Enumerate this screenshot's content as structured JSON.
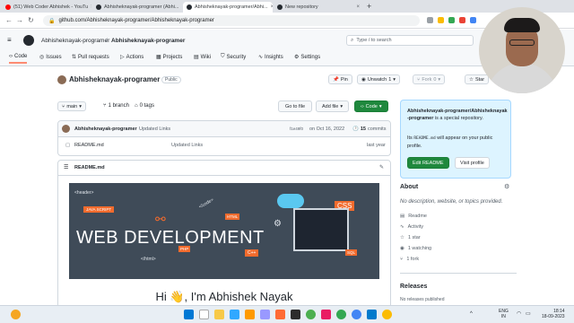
{
  "browser": {
    "tabs": [
      {
        "title": "(51) Web Coder Abhishek - YouTu",
        "color": "#ff0000",
        "active": false
      },
      {
        "title": "Abhisheknayak-programer (Abhi...",
        "color": "#24292f",
        "active": false
      },
      {
        "title": "Abhisheknayak-programer/Abhi...",
        "color": "#24292f",
        "active": true
      },
      {
        "title": "New repository",
        "color": "#24292f",
        "active": false
      }
    ],
    "url": "github.com/Abhisheknayak-programer/Abhisheknayak-programer"
  },
  "github": {
    "owner": "Abhisheknayak-programer",
    "sep": "/",
    "repo": "Abhisheknayak-programer",
    "search_placeholder": "Type / to search",
    "nav": [
      {
        "label": "Code",
        "icon": "code-icon"
      },
      {
        "label": "Issues",
        "icon": "issue-icon"
      },
      {
        "label": "Pull requests",
        "icon": "pr-icon"
      },
      {
        "label": "Actions",
        "icon": "play-icon"
      },
      {
        "label": "Projects",
        "icon": "table-icon"
      },
      {
        "label": "Wiki",
        "icon": "book-icon"
      },
      {
        "label": "Security",
        "icon": "shield-icon"
      },
      {
        "label": "Insights",
        "icon": "graph-icon"
      },
      {
        "label": "Settings",
        "icon": "gear-icon"
      }
    ]
  },
  "repo": {
    "title": "Abhisheknayak-programer",
    "visibility": "Public",
    "pin": "Pin",
    "unwatch": "Unwatch",
    "watch_count": "1",
    "fork": "Fork",
    "fork_count": "0",
    "star": "Star",
    "branch": "main",
    "branches": "1 branch",
    "tags": "0 tags",
    "goto_file": "Go to file",
    "add_file": "Add file",
    "code_btn": "Code",
    "commit_author": "Abhisheknayak-programer",
    "commit_msg": "Updated Links",
    "commit_hash": "f1e49f0",
    "commit_date": "on Oct 16, 2022",
    "commits": "15",
    "commits_label": "commits",
    "file_name": "README.md",
    "file_msg": "Updated Links",
    "file_time": "last year",
    "readme_header": "README.md",
    "banner": {
      "text": "WEB DEVELOPMENT",
      "tags": [
        "<header>",
        "JAVA SCRIPT",
        "</code>",
        "HTML",
        "CSS",
        "PHP",
        "C++",
        "</html>",
        "SQL"
      ]
    },
    "greeting": "Hi 👋, I'm Abhishek Nayak"
  },
  "sidebar": {
    "special_owner": "Abhisheknayak-programer/Abhisheknayak-programer",
    "special_text": " is a special repository.",
    "special_line2_a": "Its ",
    "special_code": "README.md",
    "special_line2_b": " will appear on your public profile.",
    "edit_readme": "Edit README",
    "visit_profile": "Visit profile",
    "about_title": "About",
    "about_desc": "No description, website, or topics provided.",
    "items": [
      {
        "label": "Readme",
        "icon": "book-icon"
      },
      {
        "label": "Activity",
        "icon": "pulse-icon"
      },
      {
        "label": "1 star",
        "icon": "star-icon"
      },
      {
        "label": "1 watching",
        "icon": "eye-icon"
      },
      {
        "label": "1 fork",
        "icon": "fork-icon"
      }
    ],
    "releases_title": "Releases",
    "releases_text": "No releases published"
  },
  "taskbar": {
    "lang": "ENG",
    "region": "IN",
    "time": "18:14",
    "date": "18-09-2023"
  }
}
